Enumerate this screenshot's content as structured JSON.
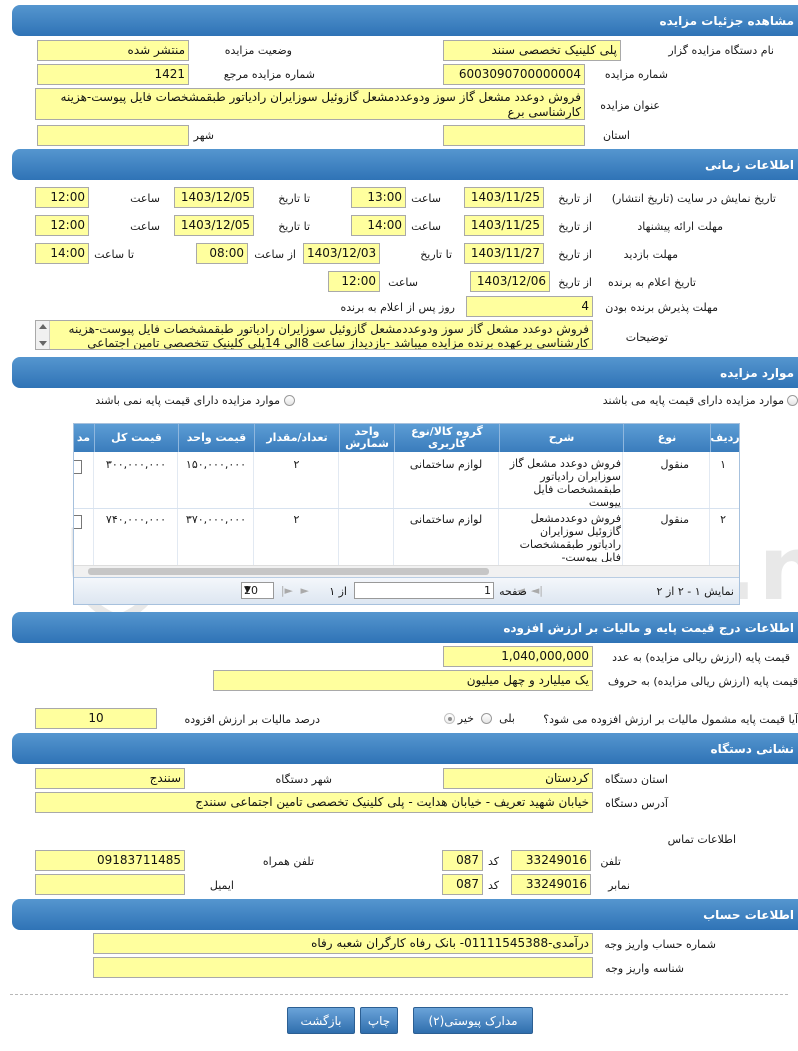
{
  "sections": {
    "auction_details": "مشاهده جزئیات مزایده",
    "timing": "اطلاعات زمانی",
    "items": "موارد مزایده",
    "base_price": "اطلاعات درج قیمت پایه و مالیات بر ارزش افزوده",
    "device_address": "نشانی دستگاه",
    "account": "اطلاعات حساب"
  },
  "details": {
    "org_label": "نام دستگاه مزایده گزار",
    "org_value": "پلی کلینیک تخصصی سنند",
    "status_label": "وضعیت مزایده",
    "status_value": "منتشر شده",
    "number_label": "شماره مزایده",
    "number_value": "6003090700000004",
    "ref_label": "شماره مزایده مرجع",
    "ref_value": "1421",
    "title_label": "عنوان مزایده",
    "title_value": "فروش دوعدد مشعل گاز سوز ودوعددمشعل گازوئیل سوزایران رادیاتور طبقمشخصات فایل پیوست-هزینه کارشناسی برع",
    "province_label": "استان",
    "province_value": "",
    "city_label": "شهر",
    "city_value": ""
  },
  "timing": {
    "display_label": "تاریخ نمایش در سایت (تاریخ انتشار)",
    "offer_label": "مهلت ارائه پیشنهاد",
    "visit_label": "مهلت بازدید",
    "winner_label": "تاریخ اعلام به برنده",
    "accept_label": "مهلت پذیرش برنده بودن",
    "desc_label": "توضیحات",
    "from_date": "از تاریخ",
    "to_date": "تا تاریخ",
    "hour": "ساعت",
    "from_hour": "از ساعت",
    "to_hour": "تا ساعت",
    "display_from_date": "1403/11/25",
    "display_from_time": "13:00",
    "display_to_date": "1403/12/05",
    "display_to_time": "12:00",
    "offer_from_date": "1403/11/25",
    "offer_from_time": "14:00",
    "offer_to_date": "1403/12/05",
    "offer_to_time": "12:00",
    "visit_from_date": "1403/11/27",
    "visit_to_date": "1403/12/03",
    "visit_from_time": "08:00",
    "visit_to_time": "14:00",
    "winner_date": "1403/12/06",
    "winner_time": "12:00",
    "accept_days": "4",
    "accept_suffix": "روز پس از اعلام به برنده",
    "desc_line1": "فروش دوعدد مشعل گاز سوز ودوعددمشعل گازوئیل سوزایران رادیاتور طبقمشخصات فایل پیوست-هزینه",
    "desc_line2": "کارشناسی برعهده برنده مزایده میباشد -بازدیداز ساعت 8الی 14پلی کلینیک تتخصصی تامین اجتماعی"
  },
  "items": {
    "option_with_base": "موارد مزایده دارای قیمت پایه می باشند",
    "option_without_base": "موارد مزایده دارای قیمت پایه نمی باشند",
    "columns": {
      "row": "ردیف",
      "type": "نوع",
      "desc": "شرح",
      "group": "گروه کالا/نوع کاربری",
      "unit": "واحد شمارش",
      "qty": "تعداد/مقدار",
      "unit_price": "قیمت واحد",
      "total": "قیمت کل",
      "extra": "مد"
    },
    "rows": [
      {
        "row": "۱",
        "type": "منقول",
        "desc": "فروش دوعدد مشعل گاز سوزایران رادیاتور طبقمشخصات فایل پیوست",
        "group": "لوازم ساختمانی",
        "unit": "",
        "qty": "۲",
        "unit_price": "۱۵۰,۰۰۰,۰۰۰",
        "total": "۳۰۰,۰۰۰,۰۰۰"
      },
      {
        "row": "۲",
        "type": "منقول",
        "desc": "فروش دوعددمشعل گازوئیل سوزایران رادیاتور طبقمشخصات فایل پیوست-",
        "group": "لوازم ساختمانی",
        "unit": "",
        "qty": "۲",
        "unit_price": "۳۷۰,۰۰۰,۰۰۰",
        "total": "۷۴۰,۰۰۰,۰۰۰"
      }
    ],
    "pager": {
      "summary": "نمایش ۱ - ۲ از ۲",
      "page_label": "صفحه",
      "page_value": "1",
      "of_label": "از ۱",
      "page_size": "20"
    }
  },
  "pricing": {
    "base_num_label": "قیمت پایه (ارزش ریالی مزایده) به عدد",
    "base_num_value": "1,040,000,000",
    "base_words_label": "قیمت پایه (ارزش ریالی مزایده) به حروف",
    "base_words_value": "یک میلیارد و چهل میلیون",
    "vat_question": "آیا قیمت پایه مشمول مالیات بر ارزش افزوده می شود؟",
    "yes": "بلی",
    "no": "خیر",
    "vat_percent_label": "درصد مالیات بر ارزش افزوده",
    "vat_percent_value": "10"
  },
  "address": {
    "province_label": "استان دستگاه",
    "province_value": "کردستان",
    "city_label": "شهر دستگاه",
    "city_value": "سنندج",
    "address_label": "آدرس دستگاه",
    "address_value": "خیابان شهید تعریف - خیابان هدایت - پلی کلینیک تخصصی تامین اجتماعی سنندج",
    "contact_label": "اطلاعات تماس",
    "phone_label": "تلفن",
    "phone_value": "33249016",
    "code_label": "کد",
    "phone_code": "087",
    "fax_label": "نمابر",
    "fax_value": "33249016",
    "fax_code": "087",
    "mobile_label": "تلفن همراه",
    "mobile_value": "09183711485",
    "email_label": "ایمیل",
    "email_value": ""
  },
  "account": {
    "number_label": "شماره حساب واریز وجه",
    "number_value": "درآمدی-01111545388- بانک رفاه کارگران شعبه رفاه",
    "id_label": "شناسه واریز وجه",
    "id_value": ""
  },
  "buttons": {
    "attachments": "مدارک پیوستی(۲)",
    "print": "چاپ",
    "back": "بازگشت"
  },
  "watermark": "AriaTender.net"
}
